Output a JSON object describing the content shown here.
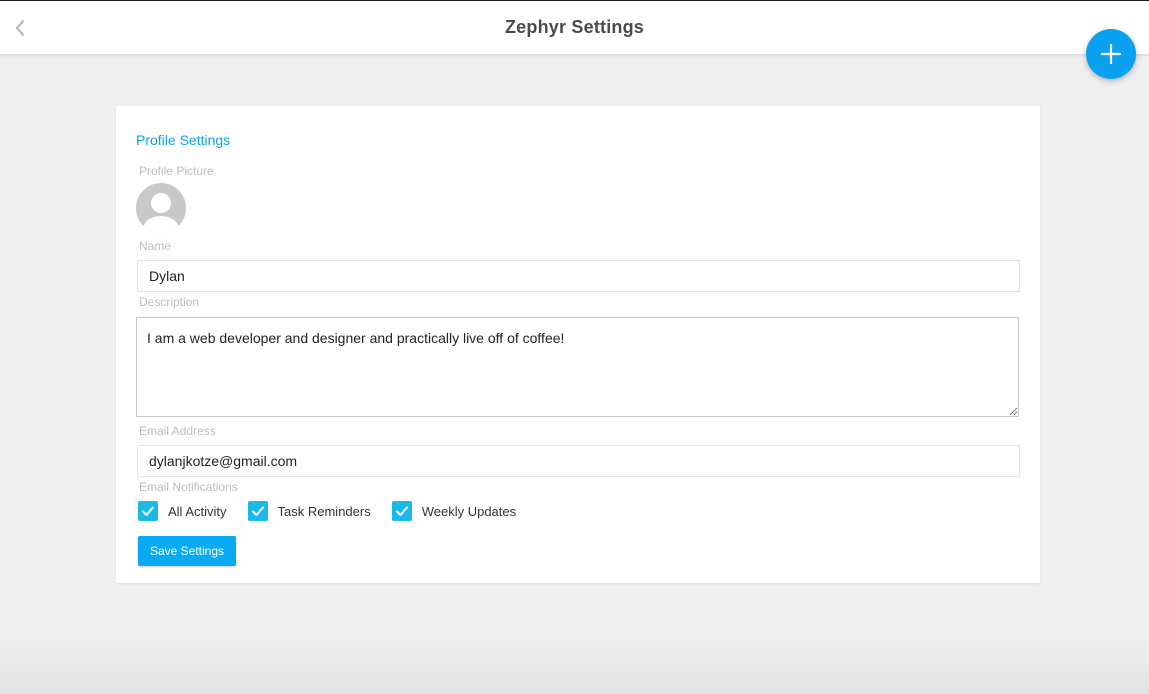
{
  "header": {
    "title": "Zephyr Settings"
  },
  "profile": {
    "section_title": "Profile Settings",
    "picture_label": "Profile Picture",
    "name_label": "Name",
    "name_value": "Dylan",
    "description_label": "Description",
    "description_value": "I am a web developer and designer and practically live off of coffee!",
    "email_label": "Email Address",
    "email_value": "dylanjkotze@gmail.com",
    "notifications_label": "Email Notifications",
    "notifications": [
      {
        "label": "All Activity",
        "checked": true
      },
      {
        "label": "Task Reminders",
        "checked": true
      },
      {
        "label": "Weekly Updates",
        "checked": true
      }
    ],
    "save_label": "Save Settings"
  },
  "icons": {
    "back": "chevron-left-icon",
    "add": "plus-icon",
    "avatar": "user-silhouette-icon",
    "check": "checkmark-icon"
  },
  "colors": {
    "accent": "#0aa2f0",
    "checkbox": "#1cb8e6",
    "background": "#efefef"
  }
}
